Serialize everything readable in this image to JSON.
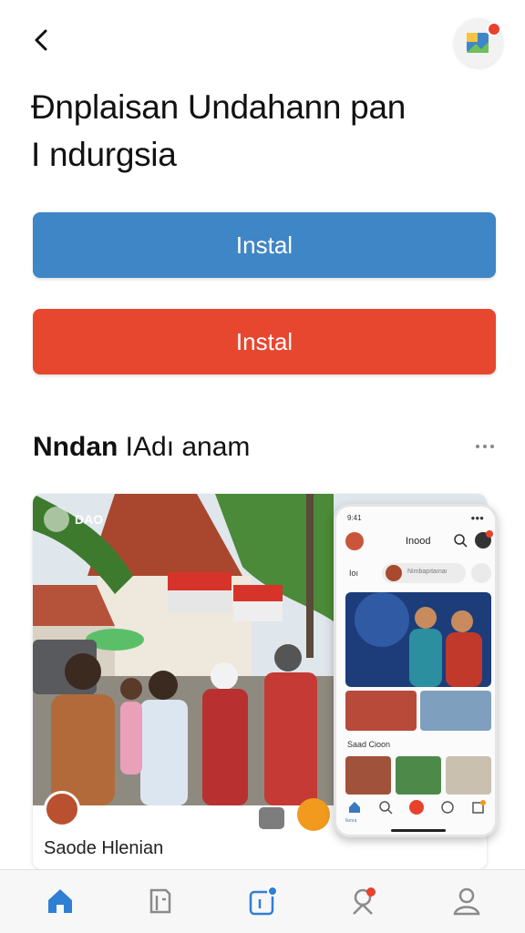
{
  "header": {
    "back_icon": "chevron-left-icon",
    "app_icon": "app-logo-icon"
  },
  "title": {
    "line1": "Ðnplaisan Undahann pan",
    "line2": "I ndurgsia"
  },
  "buttons": {
    "primary_label": "Instal",
    "secondary_label": "Instal",
    "primary_color": "#3f86c6",
    "secondary_color": "#e8472f"
  },
  "section": {
    "title_bold": "Nndan",
    "title_rest": " IAdı anam",
    "more_label": "•••"
  },
  "card": {
    "badge_label": "DAO",
    "caption": "Saode Hlenian"
  },
  "phone_preview": {
    "status_time": "9:41",
    "status_signal": "●●●",
    "title": "Inood",
    "bar_label": "Ioı",
    "search_pill": "Nimbapıtaınaı",
    "subheading": "Saad Cioon",
    "nav_home_label": "Ikınıa"
  },
  "bottom_nav": {
    "items": [
      "home-icon",
      "book-icon",
      "edit-icon",
      "location-icon",
      "profile-icon"
    ],
    "accent": "#2f7fd4"
  }
}
